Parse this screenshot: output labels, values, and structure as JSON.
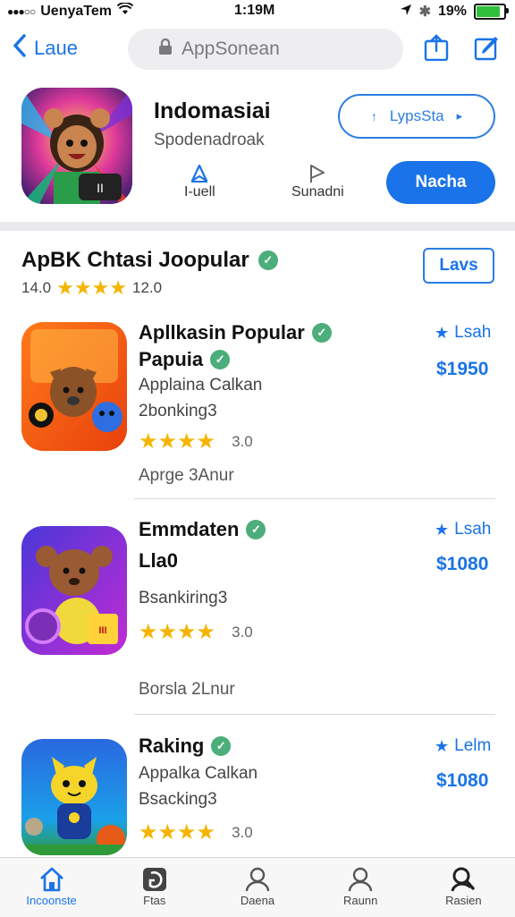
{
  "status_bar": {
    "carrier": "UenyaTem",
    "time": "1:19M",
    "battery": "19%"
  },
  "nav": {
    "back_label": "Laue",
    "search_placeholder": "AppSonean"
  },
  "header_app": {
    "title": "Indomasiai",
    "subtitle": "Spodenadroak",
    "outline_button": "LypsSta",
    "action_1": "I-uell",
    "action_2": "Sunadni",
    "primary_button": "Nacha"
  },
  "section": {
    "title": "ApBK Chtasi Joopular",
    "rating_left": "14.0",
    "rating_right": "12.0",
    "button": "Lavs"
  },
  "items": [
    {
      "title": "Apllkasin Popular",
      "title2": "Papuia",
      "line1": "Applaina Calkan",
      "line2": "2bonking3",
      "rating_count": "3.0",
      "footer": "Aprge 3Anur",
      "right_label": "Lsah",
      "price": "$1950"
    },
    {
      "title": "Emmdaten",
      "title2": "Lla0",
      "line1": "",
      "line2": "Bsankiring3",
      "rating_count": "3.0",
      "footer": "Borsla 2Lnur",
      "right_label": "Lsah",
      "price": "$1080"
    },
    {
      "title": "Raking",
      "title2": "",
      "line1": "Appalka Calkan",
      "line2": "Bsacking3",
      "rating_count": "3.0",
      "footer": "",
      "right_label": "Lelm",
      "price": "$1080"
    }
  ],
  "tabs": [
    {
      "label": "Incoonste",
      "icon": "home-icon"
    },
    {
      "label": "Ftas",
      "icon": "games-icon"
    },
    {
      "label": "Daena",
      "icon": "person-icon"
    },
    {
      "label": "Raunn",
      "icon": "person-icon"
    },
    {
      "label": "Rasien",
      "icon": "search-person-icon"
    }
  ],
  "colors": {
    "accent": "#1a73e8",
    "star": "#f5b400",
    "check": "#4cae7a"
  }
}
